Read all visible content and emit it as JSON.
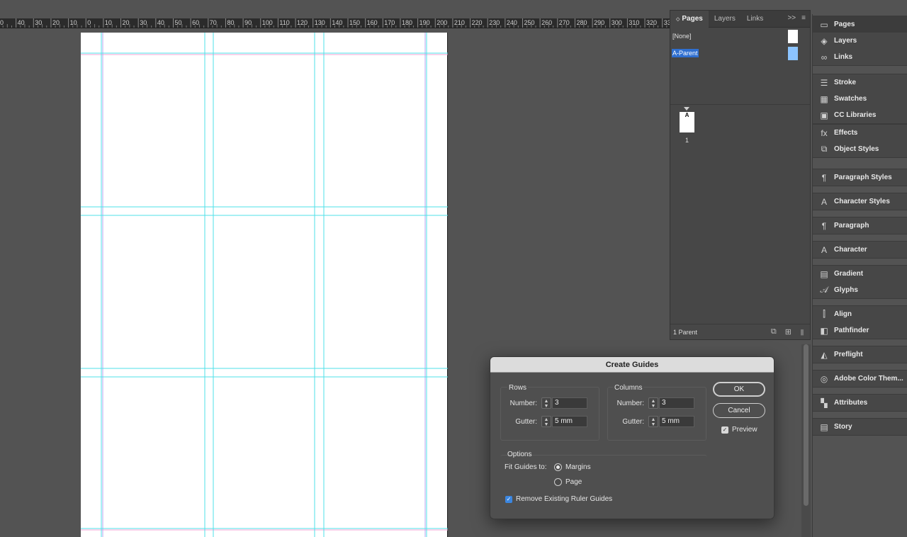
{
  "ruler": {
    "ticks": [
      "0",
      "40",
      "30",
      "20",
      "10",
      "0",
      "10",
      "20",
      "30",
      "40",
      "50",
      "60",
      "70",
      "80",
      "90",
      "100",
      "110",
      "120",
      "130",
      "140",
      "150",
      "160",
      "170",
      "180",
      "190",
      "200",
      "210",
      "220",
      "230",
      "240",
      "250",
      "260",
      "270",
      "280",
      "290",
      "300",
      "310",
      "320",
      "330"
    ]
  },
  "pages_panel": {
    "tabs": [
      {
        "label": "Pages",
        "active": true
      },
      {
        "label": "Layers",
        "active": false
      },
      {
        "label": "Links",
        "active": false
      }
    ],
    "more_glyph": ">>",
    "menu_glyph": "≡",
    "parents": [
      {
        "label": "[None]",
        "selected": false
      },
      {
        "label": "A-Parent",
        "selected": true
      }
    ],
    "page_thumb_letter": "A",
    "page_number": "1",
    "footer_text": "1 Parent"
  },
  "dock": {
    "groups": [
      [
        {
          "label": "Pages",
          "icon": "pages-icon",
          "glyph": "▭"
        },
        {
          "label": "Layers",
          "icon": "layers-icon",
          "glyph": "◈"
        },
        {
          "label": "Links",
          "icon": "links-icon",
          "glyph": "∞"
        }
      ],
      [
        {
          "label": "Stroke",
          "icon": "stroke-icon",
          "glyph": "☰"
        },
        {
          "label": "Swatches",
          "icon": "swatches-icon",
          "glyph": "▦"
        },
        {
          "label": "CC Libraries",
          "icon": "cc-libraries-icon",
          "glyph": "▣"
        }
      ],
      [
        {
          "label": "Effects",
          "icon": "effects-icon",
          "glyph": "fx"
        },
        {
          "label": "Object Styles",
          "icon": "object-styles-icon",
          "glyph": "⧉"
        }
      ],
      [
        {
          "label": "Paragraph Styles",
          "icon": "paragraph-styles-icon",
          "glyph": "¶"
        }
      ],
      [
        {
          "label": "Character Styles",
          "icon": "character-styles-icon",
          "glyph": "A"
        }
      ],
      [
        {
          "label": "Paragraph",
          "icon": "paragraph-icon",
          "glyph": "¶"
        }
      ],
      [
        {
          "label": "Character",
          "icon": "character-icon",
          "glyph": "A"
        }
      ],
      [
        {
          "label": "Gradient",
          "icon": "gradient-icon",
          "glyph": "▤"
        },
        {
          "label": "Glyphs",
          "icon": "glyphs-icon",
          "glyph": "𝒜"
        }
      ],
      [
        {
          "label": "Align",
          "icon": "align-icon",
          "glyph": "⫿"
        },
        {
          "label": "Pathfinder",
          "icon": "pathfinder-icon",
          "glyph": "◧"
        }
      ],
      [
        {
          "label": "Preflight",
          "icon": "preflight-icon",
          "glyph": "◭"
        }
      ],
      [
        {
          "label": "Adobe Color Them...",
          "icon": "adobe-color-themes-icon",
          "glyph": "◎"
        }
      ],
      [
        {
          "label": "Attributes",
          "icon": "attributes-icon",
          "glyph": "▚"
        }
      ],
      [
        {
          "label": "Story",
          "icon": "story-icon",
          "glyph": "▤"
        }
      ]
    ]
  },
  "dialog": {
    "title": "Create Guides",
    "rows": {
      "legend": "Rows",
      "number_label": "Number:",
      "number_value": "3",
      "gutter_label": "Gutter:",
      "gutter_value": "5 mm"
    },
    "columns": {
      "legend": "Columns",
      "number_label": "Number:",
      "number_value": "3",
      "gutter_label": "Gutter:",
      "gutter_value": "5 mm"
    },
    "ok_label": "OK",
    "cancel_label": "Cancel",
    "preview_label": "Preview",
    "preview_checked": true,
    "options_legend": "Options",
    "fit_label": "Fit Guides to:",
    "fit_margins": "Margins",
    "fit_page": "Page",
    "fit_selected": "Margins",
    "remove_label": "Remove Existing Ruler Guides",
    "remove_checked": true
  },
  "colors": {
    "guide_cyan": "#4fe0ea",
    "margin_magenta": "#f2a6d6",
    "column_violet": "#b9a6f0",
    "selection_blue": "#2f6fd0"
  }
}
